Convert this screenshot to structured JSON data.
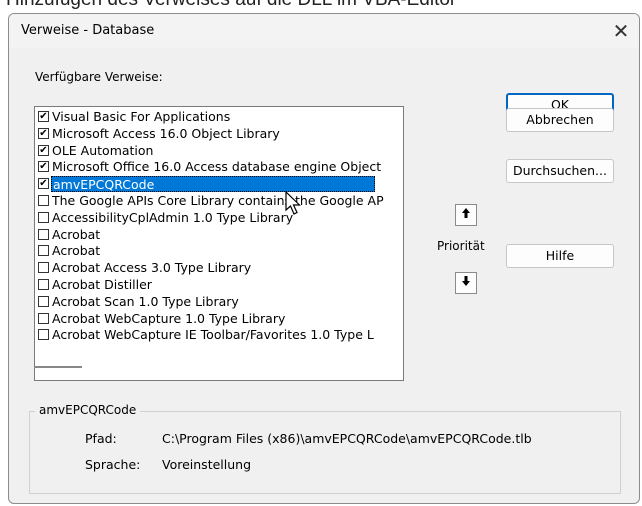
{
  "caption_fragment": "Hinzufügen des Verweises auf die DLL im VBA-Editor",
  "dialog": {
    "title": "Verweise - Database",
    "close_glyph": "✕",
    "available_label": "Verfügbare Verweise:",
    "references": [
      {
        "label": "Visual Basic For Applications",
        "checked": true,
        "selected": false
      },
      {
        "label": "Microsoft Access 16.0 Object Library",
        "checked": true,
        "selected": false
      },
      {
        "label": "OLE Automation",
        "checked": true,
        "selected": false
      },
      {
        "label": "Microsoft Office 16.0 Access database engine Object",
        "checked": true,
        "selected": false
      },
      {
        "label": "amvEPCQRCode",
        "checked": true,
        "selected": true
      },
      {
        "label": "The Google APIs Core Library contains the Google AP",
        "checked": false,
        "selected": false
      },
      {
        "label": "AccessibilityCplAdmin 1.0 Type Library",
        "checked": false,
        "selected": false
      },
      {
        "label": "Acrobat",
        "checked": false,
        "selected": false
      },
      {
        "label": "Acrobat",
        "checked": false,
        "selected": false
      },
      {
        "label": "Acrobat Access 3.0 Type Library",
        "checked": false,
        "selected": false
      },
      {
        "label": "Acrobat Distiller",
        "checked": false,
        "selected": false
      },
      {
        "label": "Acrobat Scan 1.0 Type Library",
        "checked": false,
        "selected": false
      },
      {
        "label": "Acrobat WebCapture 1.0 Type Library",
        "checked": false,
        "selected": false
      },
      {
        "label": "Acrobat WebCapture IE Toolbar/Favorites 1.0 Type L",
        "checked": false,
        "selected": false
      }
    ],
    "buttons": {
      "ok": "OK",
      "cancel": "Abbrechen",
      "browse": "Durchsuchen...",
      "help": "Hilfe"
    },
    "priority": {
      "label": "Priorität",
      "up_glyph": "🡅",
      "down_glyph": "🡇"
    },
    "details": {
      "title": "amvEPCQRCode",
      "path_label": "Pfad:",
      "path_value": "C:\\Program Files (x86)\\amvEPCQRCode\\amvEPCQRCode.tlb",
      "language_label": "Sprache:",
      "language_value": "Voreinstellung"
    }
  },
  "colors": {
    "selection": "#0078d7",
    "default_button_border": "#0067c0",
    "dialog_background": "#f0f0f0"
  }
}
